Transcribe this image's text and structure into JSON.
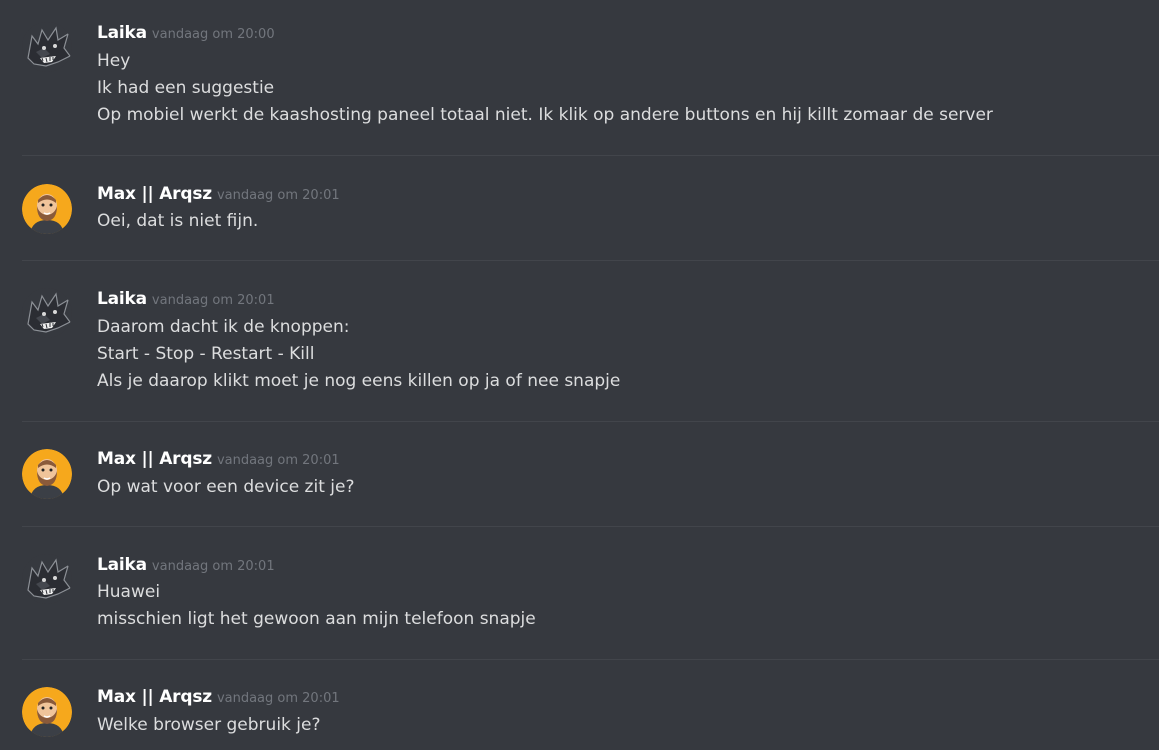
{
  "colors": {
    "background": "#36393f",
    "username": "#ffffff",
    "timestamp": "#72767d",
    "message_text": "#dcddde",
    "divider": "#42454b",
    "max_avatar_bg": "#f6a81c"
  },
  "messages": [
    {
      "author": "Laika",
      "avatar_icon": "wolf-avatar-icon",
      "timestamp": "vandaag om 20:00",
      "lines": [
        "Hey",
        "Ik had een suggestie",
        "Op mobiel werkt de kaashosting paneel totaal niet. Ik klik op andere buttons en hij killt zomaar de server"
      ]
    },
    {
      "author": "Max || Arqsz",
      "avatar_icon": "bearded-man-avatar-icon",
      "timestamp": "vandaag om 20:01",
      "lines": [
        "Oei, dat is niet fijn."
      ]
    },
    {
      "author": "Laika",
      "avatar_icon": "wolf-avatar-icon",
      "timestamp": "vandaag om 20:01",
      "lines": [
        "Daarom dacht ik de knoppen:",
        "Start - Stop - Restart - Kill",
        "Als je daarop klikt moet je nog eens killen op ja of nee snapje"
      ]
    },
    {
      "author": "Max || Arqsz",
      "avatar_icon": "bearded-man-avatar-icon",
      "timestamp": "vandaag om 20:01",
      "lines": [
        "Op wat voor een device zit je?"
      ]
    },
    {
      "author": "Laika",
      "avatar_icon": "wolf-avatar-icon",
      "timestamp": "vandaag om 20:01",
      "lines": [
        "Huawei",
        "misschien ligt het gewoon aan mijn telefoon snapje"
      ]
    },
    {
      "author": "Max || Arqsz",
      "avatar_icon": "bearded-man-avatar-icon",
      "timestamp": "vandaag om 20:01",
      "lines": [
        "Welke browser gebruik je?"
      ]
    }
  ]
}
